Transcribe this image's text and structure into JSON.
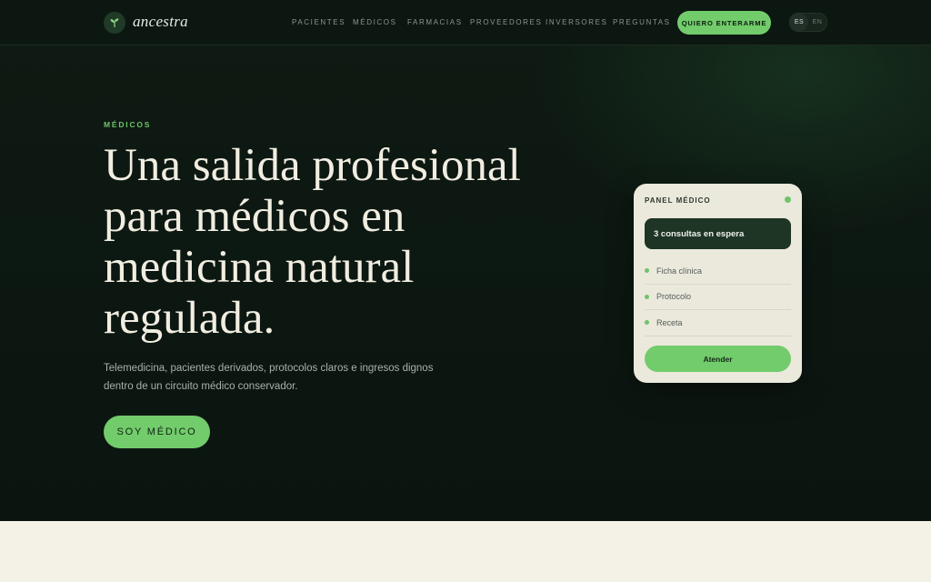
{
  "brand": {
    "name": "ancestra",
    "icon": "sprout-icon"
  },
  "nav": {
    "links": [
      "Pacientes",
      "Médicos",
      "Farmacias",
      "Proveedores",
      "Inversores",
      "Preguntas"
    ],
    "cta_label": "Quiero enterarme",
    "languages": [
      "ES",
      "EN"
    ],
    "active_language": "ES"
  },
  "hero": {
    "eyebrow": "MÉDICOS",
    "headline_lines": [
      "Una salida profesional",
      "para médicos en",
      "medicina natural",
      "regulada."
    ],
    "subtitle": "Telemedicina, pacientes derivados, protocolos claros e ingresos dignos dentro de un circuito médico conservador.",
    "cta_label": "SOY MÉDICO"
  },
  "panel": {
    "title": "PANEL MÉDICO",
    "status_color": "#6fc368",
    "banner": "3 consultas en espera",
    "items": [
      "Ficha clínica",
      "Protocolo",
      "Receta"
    ],
    "button_label": "Atender"
  },
  "colors": {
    "accent": "#72cc6b",
    "hero_bg": "#0e1a13",
    "section_bg": "#f4f1e6",
    "panel_bg": "#ebe8dc",
    "banner_bg": "#1e3424"
  }
}
